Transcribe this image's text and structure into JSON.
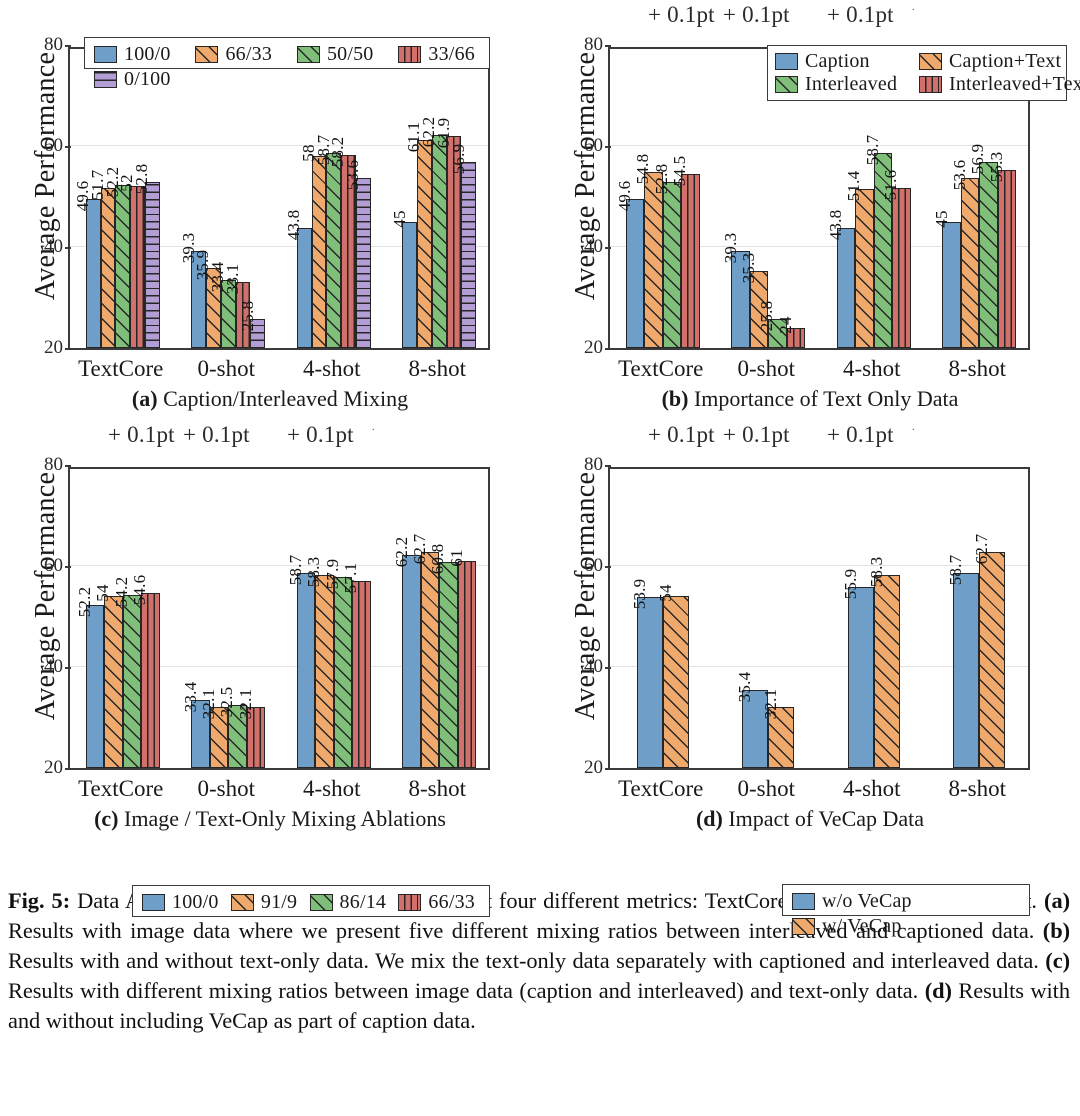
{
  "figure": {
    "caption_label": "Fig. 5:",
    "caption_text": " Data Ablations. For each ablation, we present four different metrics: TextCore, 0-shot, 4-shot, and 8-shot. ",
    "caption_a_tag": "(a)",
    "caption_a_text": " Results with image data where we present five different mixing ratios between interleaved and captioned data. ",
    "caption_b_tag": "(b)",
    "caption_b_text": " Results with and without text-only data. We mix the text-only data separately with captioned and interleaved data. ",
    "caption_c_tag": "(c)",
    "caption_c_text": " Results with different mixing ratios between image data (caption and interleaved) and text-only data. ",
    "caption_d_tag": "(d)",
    "caption_d_text": " Results with and without including VeCap as part of caption data."
  },
  "artifact": {
    "pt_label": "+ 0.1pt",
    "pt_small": "."
  },
  "colors": {
    "blue": "#6f9fc8",
    "orange": "#f0a96c",
    "green": "#7fbf79",
    "red": "#d2716c",
    "purple": "#b29dd4",
    "outline": "#262626",
    "axis": "#3a3a3a",
    "gridline": "#e2e2e2"
  },
  "chart_data": [
    {
      "id": "a",
      "type": "bar",
      "title": "Caption/Interleaved Mixing",
      "subcaption_tag": "(a)",
      "subcaption_text": " Caption/Interleaved Mixing",
      "xlabel": "",
      "ylabel": "Average Performance",
      "ylim": [
        20,
        80
      ],
      "yticks": [
        20,
        40,
        60,
        80
      ],
      "gridlines": [
        40,
        60
      ],
      "legend_position": "top-inside",
      "categories": [
        "TextCore",
        "0-shot",
        "4-shot",
        "8-shot"
      ],
      "series": [
        {
          "name": "100/0",
          "color": "blue",
          "pattern": "solid",
          "values": [
            49.6,
            39.3,
            43.8,
            45
          ],
          "labels": [
            "49.6",
            "39.3",
            "43.8",
            "45"
          ]
        },
        {
          "name": "66/33",
          "color": "orange",
          "pattern": "diagonal",
          "values": [
            51.7,
            35.9,
            58,
            61.1
          ],
          "labels": [
            "51.7",
            "35.9",
            "58",
            "61.1"
          ]
        },
        {
          "name": "50/50",
          "color": "green",
          "pattern": "diagonal",
          "values": [
            52.2,
            33.4,
            58.7,
            62.2
          ],
          "labels": [
            "52.2",
            "33.4",
            "58.7",
            "62.2"
          ]
        },
        {
          "name": "33/66",
          "color": "red",
          "pattern": "vertical",
          "values": [
            52,
            33.1,
            58.2,
            61.9
          ],
          "labels": [
            "52",
            "33.1",
            "58.2",
            "61.9"
          ]
        },
        {
          "name": "0/100",
          "color": "purple",
          "pattern": "horizontal",
          "values": [
            52.8,
            25.8,
            53.6,
            56.9
          ],
          "labels": [
            "52.8",
            "25.8",
            "53.6",
            "56.9"
          ]
        }
      ]
    },
    {
      "id": "b",
      "type": "bar",
      "title": "Importance of Text Only Data",
      "subcaption_tag": "(b)",
      "subcaption_text": " Importance of Text Only Data",
      "xlabel": "",
      "ylabel": "Average Performance",
      "ylim": [
        20,
        80
      ],
      "yticks": [
        20,
        40,
        60,
        80
      ],
      "gridlines": [
        40,
        60
      ],
      "legend_position": "top-inside",
      "categories": [
        "TextCore",
        "0-shot",
        "4-shot",
        "8-shot"
      ],
      "series": [
        {
          "name": "Caption",
          "color": "blue",
          "pattern": "solid",
          "values": [
            49.6,
            39.3,
            43.8,
            45
          ],
          "labels": [
            "49.6",
            "39.3",
            "43.8",
            "45"
          ]
        },
        {
          "name": "Caption+Text",
          "color": "orange",
          "pattern": "diagonal",
          "values": [
            54.8,
            35.3,
            51.4,
            53.6
          ],
          "labels": [
            "54.8",
            "35.3",
            "51.4",
            "53.6"
          ]
        },
        {
          "name": "Interleaved",
          "color": "green",
          "pattern": "diagonal",
          "values": [
            52.8,
            25.8,
            58.7,
            56.9
          ],
          "labels": [
            "52.8",
            "25.8",
            "58.7",
            "56.9"
          ]
        },
        {
          "name": "Interleaved+Text",
          "color": "red",
          "pattern": "vertical",
          "values": [
            54.5,
            24,
            51.6,
            55.3
          ],
          "labels": [
            "54.5",
            "24",
            "51.6",
            "55.3"
          ]
        }
      ]
    },
    {
      "id": "c",
      "type": "bar",
      "title": "Image / Text-Only Mixing Ablations",
      "subcaption_tag": "(c)",
      "subcaption_text": " Image / Text-Only Mixing Ablations",
      "xlabel": "",
      "ylabel": "Average Performance",
      "ylim": [
        20,
        80
      ],
      "yticks": [
        20,
        40,
        60,
        80
      ],
      "gridlines": [
        40,
        60
      ],
      "legend_position": "top-inside",
      "categories": [
        "TextCore",
        "0-shot",
        "4-shot",
        "8-shot"
      ],
      "series": [
        {
          "name": "100/0",
          "color": "blue",
          "pattern": "solid",
          "values": [
            52.2,
            33.4,
            58.7,
            62.2
          ],
          "labels": [
            "52.2",
            "33.4",
            "58.7",
            "62.2"
          ]
        },
        {
          "name": "91/9",
          "color": "orange",
          "pattern": "diagonal",
          "values": [
            54,
            32.1,
            58.3,
            62.7
          ],
          "labels": [
            "54",
            "32.1",
            "58.3",
            "62.7"
          ]
        },
        {
          "name": "86/14",
          "color": "green",
          "pattern": "diagonal",
          "values": [
            54.2,
            32.5,
            57.9,
            60.8
          ],
          "labels": [
            "54.2",
            "32.5",
            "57.9",
            "60.8"
          ]
        },
        {
          "name": "66/33",
          "color": "red",
          "pattern": "vertical",
          "values": [
            54.6,
            32.1,
            57.1,
            61
          ],
          "labels": [
            "54.6",
            "32.1",
            "57.1",
            "61"
          ]
        }
      ]
    },
    {
      "id": "d",
      "type": "bar",
      "title": "Impact of VeCap Data",
      "subcaption_tag": "(d)",
      "subcaption_text": " Impact of VeCap Data",
      "xlabel": "",
      "ylabel": "Average Performance",
      "ylim": [
        20,
        80
      ],
      "yticks": [
        20,
        40,
        60,
        80
      ],
      "gridlines": [
        40,
        60
      ],
      "legend_position": "top-inside",
      "categories": [
        "TextCore",
        "0-shot",
        "4-shot",
        "8-shot"
      ],
      "series": [
        {
          "name": "w/o VeCap",
          "color": "blue",
          "pattern": "solid",
          "values": [
            53.9,
            35.4,
            55.9,
            58.7
          ],
          "labels": [
            "53.9",
            "35.4",
            "55.9",
            "58.7"
          ]
        },
        {
          "name": "w/ VeCap",
          "color": "orange",
          "pattern": "diagonal",
          "values": [
            54,
            32.1,
            58.3,
            62.7
          ],
          "labels": [
            "54",
            "32.1",
            "58.3",
            "62.7"
          ]
        }
      ]
    }
  ]
}
